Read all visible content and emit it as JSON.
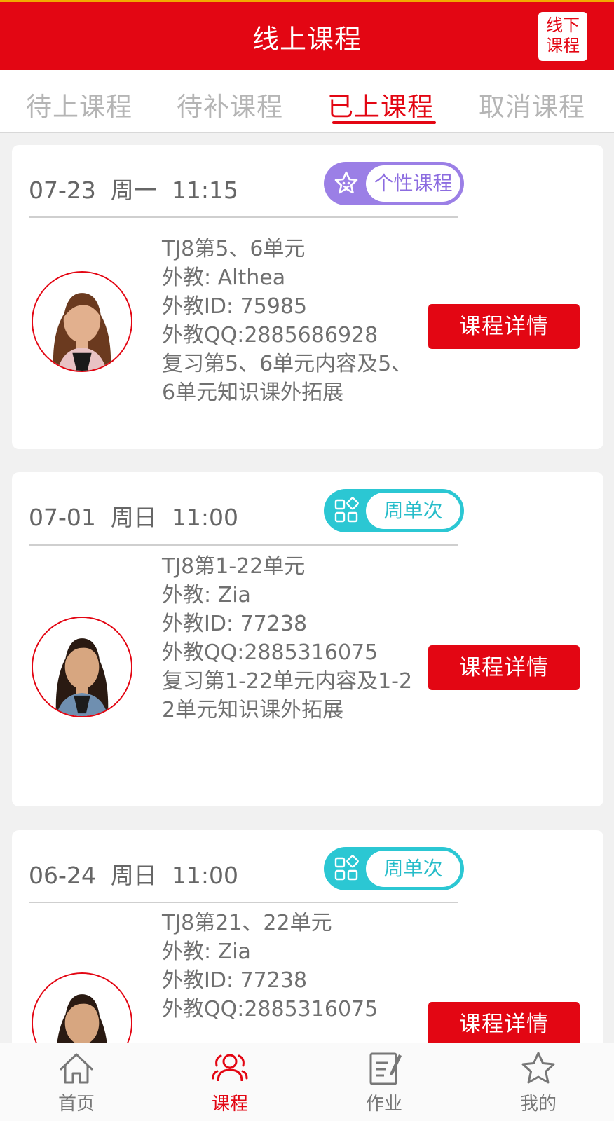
{
  "header": {
    "title": "线上课程",
    "offline_button": {
      "line1": "线下",
      "line2": "课程"
    }
  },
  "tabs": [
    {
      "label": "待上课程",
      "active": false
    },
    {
      "label": "待补课程",
      "active": false
    },
    {
      "label": "已上课程",
      "active": true
    },
    {
      "label": "取消课程",
      "active": false
    }
  ],
  "courses": [
    {
      "date": "07-23  周一  11:15",
      "badge": {
        "label": "个性课程",
        "color": "#9b7fe6",
        "icon": "star-face-icon"
      },
      "title": "TJ8第5、6单元",
      "teacher": "外教: Althea",
      "teacher_id": "外教ID: 75985",
      "teacher_qq": "外教QQ:2885686928",
      "description": "复习第5、6单元内容及5、6单元知识课外拓展",
      "detail_button": "课程详情"
    },
    {
      "date": "07-01  周日  11:00",
      "badge": {
        "label": "周单次",
        "color": "#2bc7d3",
        "icon": "grid-icon"
      },
      "title": "TJ8第1-22单元",
      "teacher": "外教: Zia",
      "teacher_id": "外教ID: 77238",
      "teacher_qq": "外教QQ:2885316075",
      "description": "复习第1-22单元内容及1-22单元知识课外拓展",
      "detail_button": "课程详情"
    },
    {
      "date": "06-24  周日  11:00",
      "badge": {
        "label": "周单次",
        "color": "#2bc7d3",
        "icon": "grid-icon"
      },
      "title": "TJ8第21、22单元",
      "teacher": "外教: Zia",
      "teacher_id": "外教ID: 77238",
      "teacher_qq": "外教QQ:2885316075",
      "detail_button": "课程详情"
    }
  ],
  "bottom_nav": [
    {
      "label": "首页",
      "icon": "home-icon",
      "active": false
    },
    {
      "label": "课程",
      "icon": "people-icon",
      "active": true
    },
    {
      "label": "作业",
      "icon": "homework-icon",
      "active": false
    },
    {
      "label": "我的",
      "icon": "star-icon",
      "active": false
    }
  ],
  "colors": {
    "brand": "#e30613",
    "accent_bar": "#f2a900",
    "badge_purple": "#9b7fe6",
    "badge_cyan": "#2bc7d3"
  }
}
